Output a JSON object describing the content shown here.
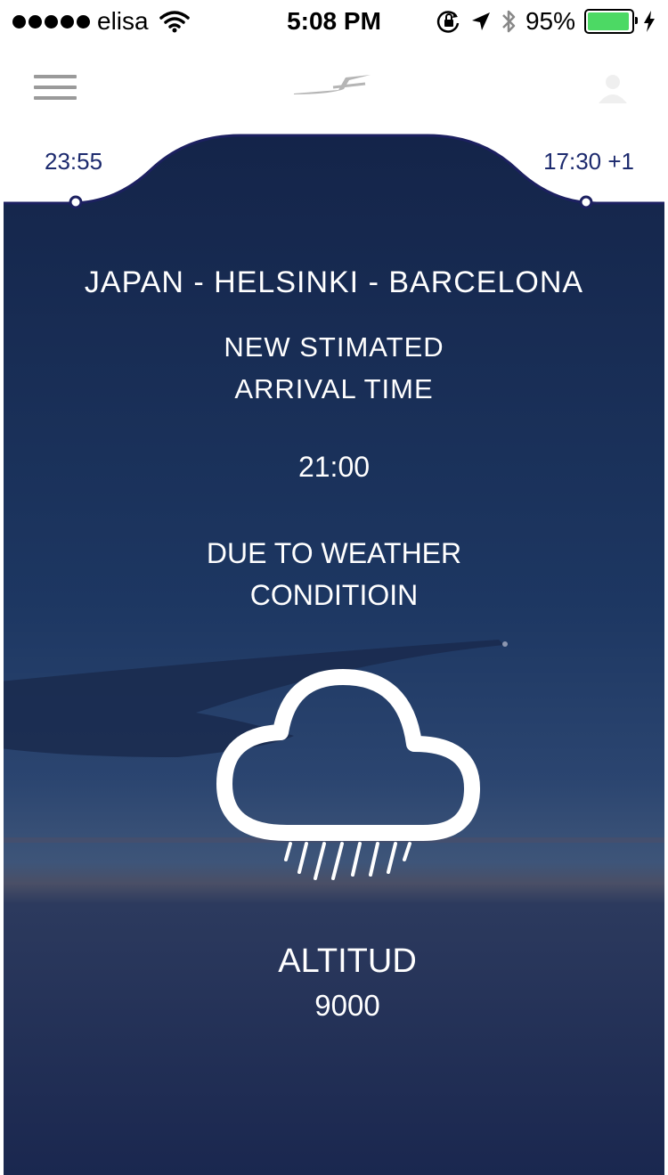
{
  "status_bar": {
    "carrier": "elisa",
    "time": "5:08 PM",
    "battery_percent": "95%",
    "battery_level": 0.95,
    "icons": [
      "signal-dots-icon",
      "wifi-icon",
      "orientation-lock-icon",
      "location-arrow-icon",
      "bluetooth-icon",
      "battery-icon",
      "charging-bolt-icon"
    ]
  },
  "nav": {
    "icons": [
      "hamburger-menu-icon",
      "airline-logo-icon",
      "user-icon"
    ]
  },
  "timeline": {
    "departure": "23:55",
    "arrival": "17:30 +1"
  },
  "flight": {
    "route": "JAPAN - HELSINKI - BARCELONA",
    "eta_label_line1": "NEW STIMATED",
    "eta_label_line2": "ARRIVAL TIME",
    "eta_time": "21:00",
    "reason_line1": "DUE TO WEATHER",
    "reason_line2": "CONDITIOIN",
    "weather_icon": "rain-cloud-icon",
    "altitude_label": "ALTITUD",
    "altitude_value": "9000"
  },
  "colors": {
    "navy": "#1c2a6e",
    "panel_dark": "#14254d",
    "battery_green": "#4cd964"
  }
}
